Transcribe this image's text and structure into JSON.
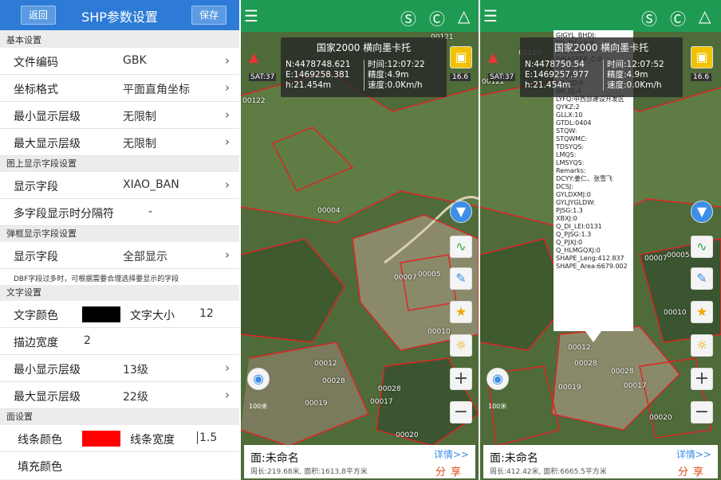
{
  "settings": {
    "back": "返回",
    "title": "SHP参数设置",
    "save": "保存",
    "sec_basic": "基本设置",
    "encoding_label": "文件编码",
    "encoding_value": "GBK",
    "coord_label": "坐标格式",
    "coord_value": "平面直角坐标",
    "minlevel_label": "最小显示层级",
    "minlevel_value": "无限制",
    "maxlevel_label": "最大显示层级",
    "maxlevel_value": "无限制",
    "sec_mapfield": "图上显示字段设置",
    "field_label": "显示字段",
    "field_value": "XIAO_BAN",
    "sep_label": "多字段显示时分隔符",
    "sep_value": "-",
    "sec_popup": "弹框显示字段设置",
    "popup_label": "显示字段",
    "popup_value": "全部显示",
    "popup_note": "DBF字段过多时，可根据需要合理选择要显示的字段",
    "sec_text": "文字设置",
    "textcolor_label": "文字颜色",
    "textsize_label": "文字大小",
    "textsize_value": "12",
    "stroke_label": "描边宽度",
    "stroke_value": "2",
    "tminlevel_label": "最小显示层级",
    "tminlevel_value": "13级",
    "tmaxlevel_label": "最大显示层级",
    "tmaxlevel_value": "22级",
    "sec_face": "面设置",
    "linecolor_label": "线条颜色",
    "linewidth_label": "线条宽度",
    "linewidth_value": "1.5",
    "fillcolor_label": "填充颜色",
    "colors": {
      "text": "#000000",
      "line": "#ff0000",
      "accent": "#2d7bd6"
    }
  },
  "map1": {
    "header": "国家2000  横向墨卡托",
    "n": "N:4478748.621",
    "e": "E:1469258.381",
    "h": "h:21.454m",
    "time": "时间:12:07:22",
    "accuracy": "精度:4.9m",
    "speed": "速度:0.0Km/h",
    "sat": "SAT:37",
    "zoom": "16.6",
    "scale": "100米",
    "labels": [
      "00121",
      "00122",
      "00004",
      "00007",
      "00005",
      "00010",
      "00012",
      "00028",
      "00019",
      "00017",
      "00028",
      "00020"
    ],
    "bottom_name": "面:未命名",
    "bottom_stat": "周长:219.68米, 面积:1613.8平方米",
    "detail": "详情>>",
    "share": "分享"
  },
  "map2": {
    "header": "国家2000  横向墨卡托",
    "n": "N:4478750.54",
    "e": "E:1469257.977",
    "h": "h:21.454m",
    "time": "时间:12:07:52",
    "accuracy": "精度:4.9m",
    "speed": "速度:0.0Km/h",
    "sat": "SAT:37",
    "zoom": "16.6",
    "scale": "100米",
    "labels": [
      "00120",
      "00122",
      "00007",
      "00005",
      "00010",
      "00012",
      "00028",
      "00019",
      "00017",
      "00028",
      "00020"
    ],
    "popup": [
      "GJGYL_BHDJ:",
      "TD_TH_LX:0",
      "DISPE:00",
      "DISASTER_C:0",
      "ZL_DJ:4",
      "LD_KD:0",
      "LD_CD:0",
      "BH_DJ:4",
      "LYFQ:中西部建设开发区",
      "QYKZ:2",
      "GLLX:10",
      "GTDL:0404",
      "STQW:",
      "STQWMC:",
      "TDSYQS:",
      "LMQS:",
      "LMSYQS:",
      "Remarks:",
      "DCYY:姜仁、张雪飞",
      "DCSJ:",
      "GYLDXMJ:0",
      "GYLJYGLDW:",
      "PJSG:1.3",
      "XBXJ:0",
      "Q_DI_LEI:0131",
      "Q_PJSG:1.3",
      "Q_PJXJ:0",
      "Q_HLMGQXJ:0",
      "SHAPE_Leng:412.837",
      "SHAPE_Area:6679.002"
    ],
    "bottom_name": "面:未命名",
    "bottom_stat": "周长:412.42米, 面积:6665.5平方米",
    "detail": "详情>>",
    "share": "分享"
  }
}
